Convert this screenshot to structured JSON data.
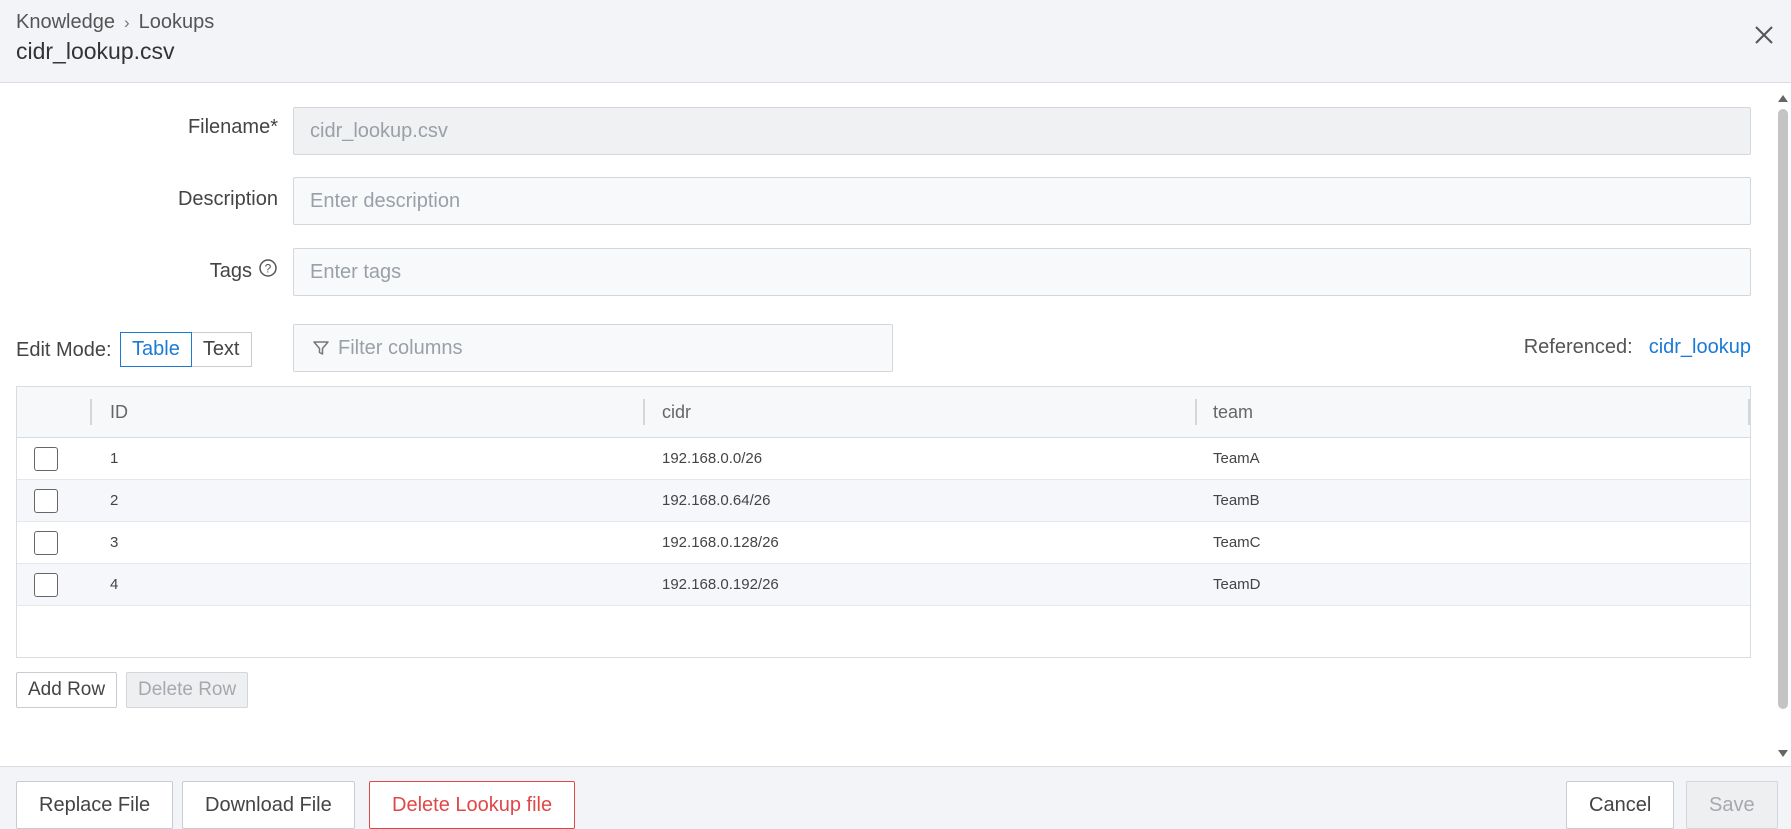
{
  "header": {
    "breadcrumb": [
      "Knowledge",
      "Lookups"
    ],
    "breadcrumb_separator": "›",
    "title": "cidr_lookup.csv"
  },
  "form": {
    "filename_label": "Filename*",
    "filename_placeholder": "cidr_lookup.csv",
    "description_label": "Description",
    "description_placeholder": "Enter description",
    "tags_label": "Tags",
    "tags_placeholder": "Enter tags"
  },
  "toolbar": {
    "edit_mode_label": "Edit Mode:",
    "modes": [
      "Table",
      "Text"
    ],
    "active_mode": "Table",
    "filter_placeholder": "Filter columns",
    "referenced_label": "Referenced:",
    "referenced_link": "cidr_lookup"
  },
  "table": {
    "columns": [
      "ID",
      "cidr",
      "team"
    ],
    "rows": [
      {
        "id": "1",
        "cidr": "192.168.0.0/26",
        "team": "TeamA"
      },
      {
        "id": "2",
        "cidr": "192.168.0.64/26",
        "team": "TeamB"
      },
      {
        "id": "3",
        "cidr": "192.168.0.128/26",
        "team": "TeamC"
      },
      {
        "id": "4",
        "cidr": "192.168.0.192/26",
        "team": "TeamD"
      }
    ],
    "add_row_label": "Add Row",
    "delete_row_label": "Delete Row"
  },
  "footer": {
    "replace_label": "Replace File",
    "download_label": "Download File",
    "delete_label": "Delete Lookup file",
    "cancel_label": "Cancel",
    "save_label": "Save"
  },
  "colors": {
    "accent": "#1a7ad6",
    "danger": "#e04848"
  }
}
